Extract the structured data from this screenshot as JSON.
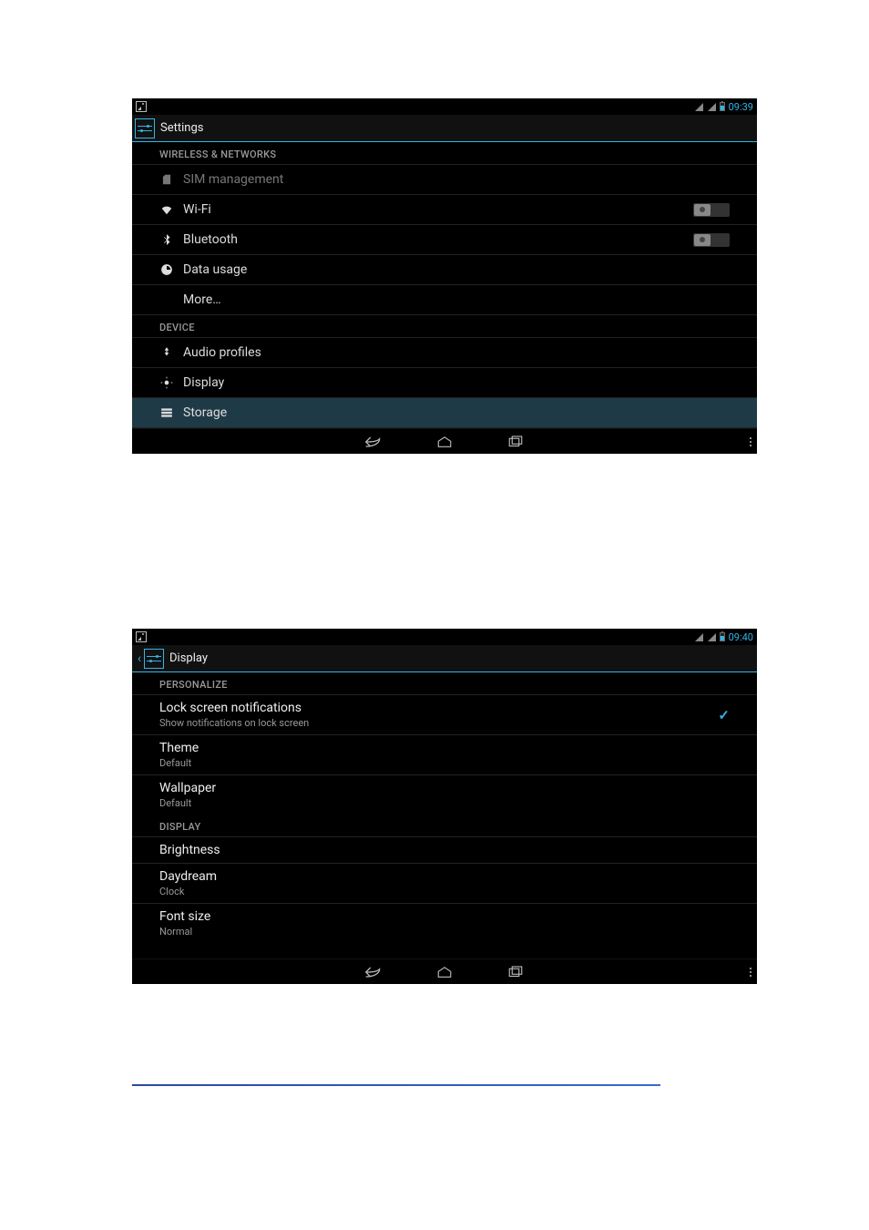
{
  "screen1": {
    "status": {
      "time": "09:39"
    },
    "title": "Settings",
    "sections": {
      "wireless_header": "WIRELESS & NETWORKS",
      "device_header": "DEVICE"
    },
    "rows": {
      "sim": "SIM management",
      "wifi": "Wi-Fi",
      "bluetooth": "Bluetooth",
      "data": "Data usage",
      "more": "More…",
      "audio": "Audio profiles",
      "display": "Display",
      "storage": "Storage"
    },
    "toggles": {
      "wifi": "off",
      "bluetooth": "off"
    }
  },
  "screen2": {
    "status": {
      "time": "09:40"
    },
    "title": "Display",
    "sections": {
      "personalize": "PERSONALIZE",
      "display": "DISPLAY"
    },
    "prefs": {
      "lockscreen": {
        "title": "Lock screen notifications",
        "sub": "Show notifications on lock screen",
        "checked": true
      },
      "theme": {
        "title": "Theme",
        "sub": "Default"
      },
      "wallpaper": {
        "title": "Wallpaper",
        "sub": "Default"
      },
      "brightness": {
        "title": "Brightness"
      },
      "daydream": {
        "title": "Daydream",
        "sub": "Clock"
      },
      "fontsize": {
        "title": "Font size",
        "sub": "Normal"
      }
    }
  }
}
